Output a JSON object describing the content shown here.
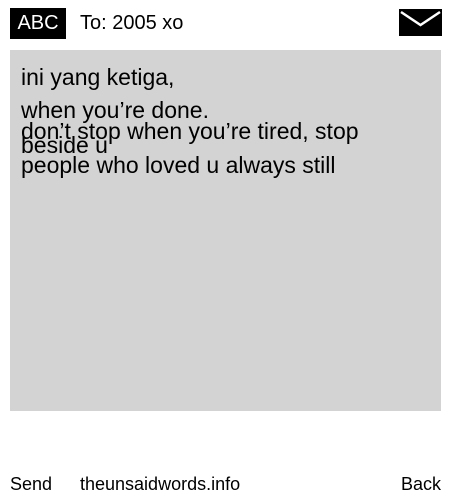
{
  "header": {
    "abc_label": "ABC",
    "to_line": "To: 2005 xo",
    "mail_icon": "envelope-icon"
  },
  "message": {
    "lines": [
      "ini yang ketiga,",
      "when you’re done.",
      "don’t stop when you’re tired, stop",
      "beside u",
      "people who loved u always still"
    ],
    "background_color": "#d3d3d3"
  },
  "footer": {
    "send_label": "Send",
    "site_label": "theunsaidwords.info",
    "back_label": "Back"
  }
}
